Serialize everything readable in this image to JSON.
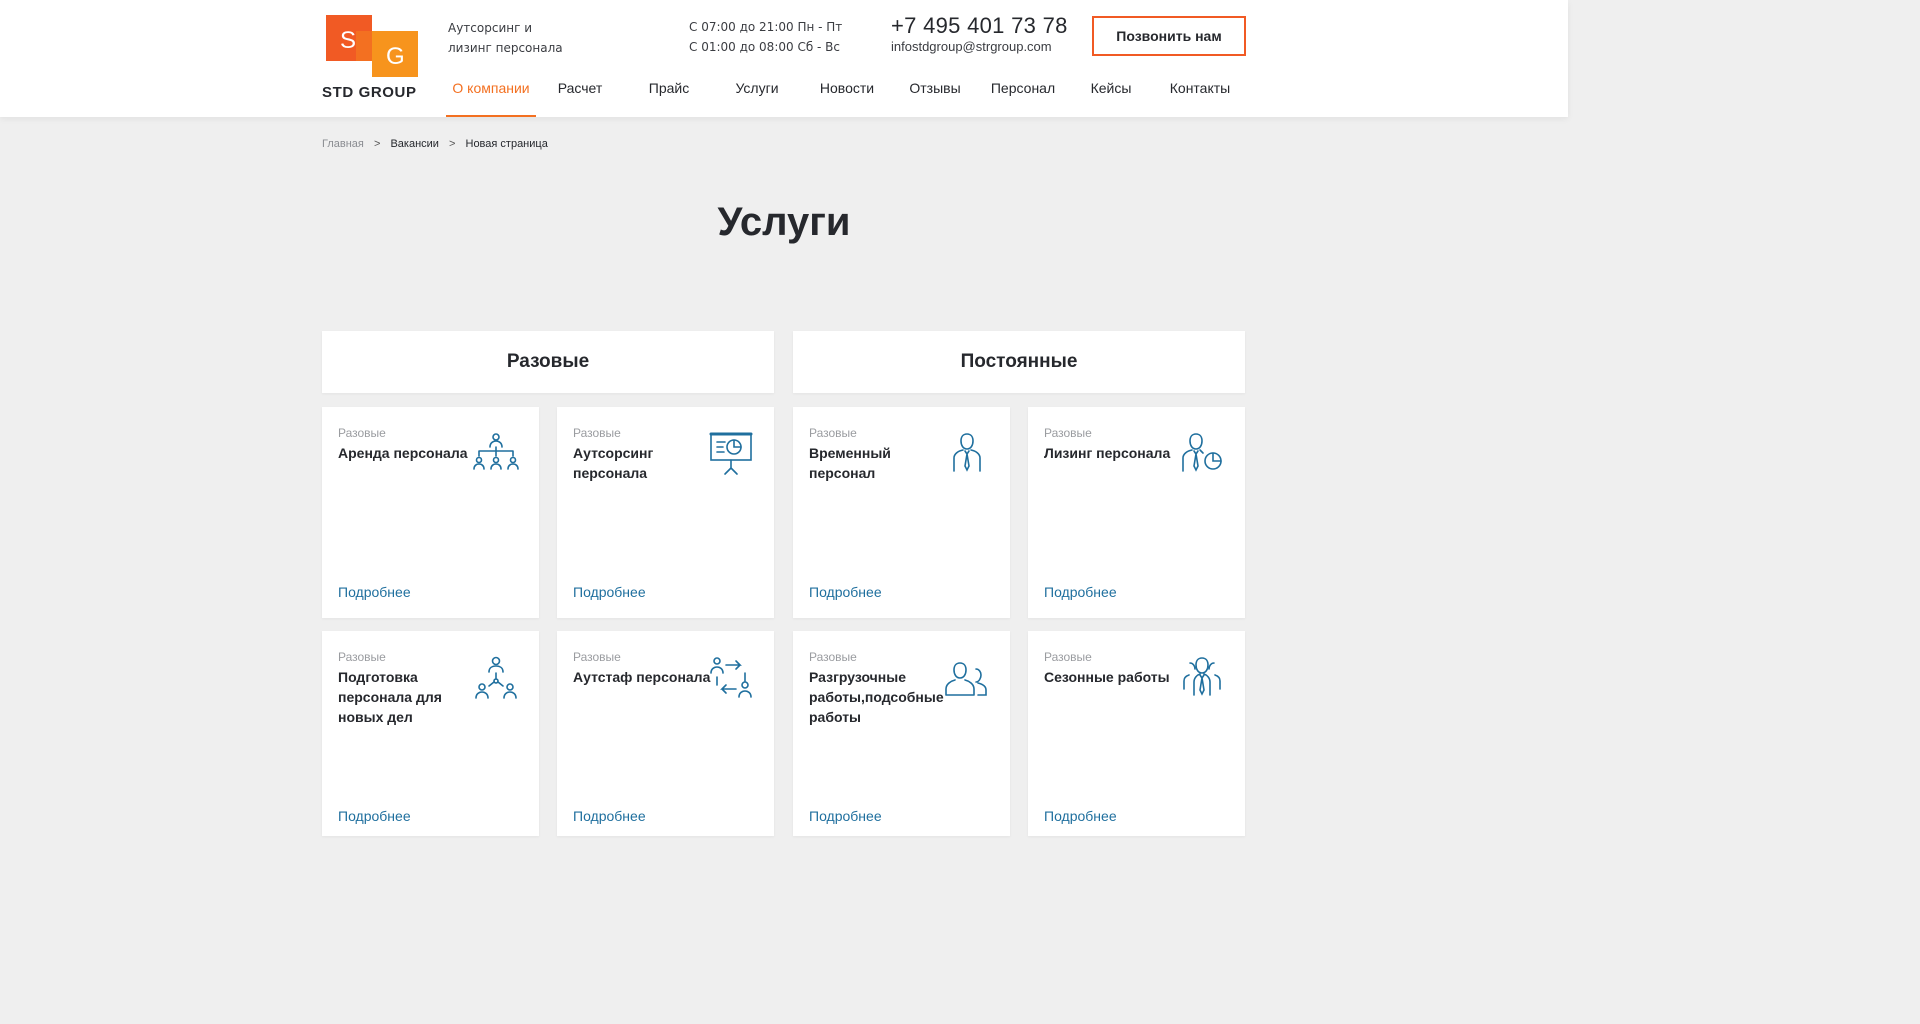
{
  "header": {
    "logo_letters": [
      "S",
      "G"
    ],
    "logo_text": "STD GROUP",
    "tagline": [
      "Аутсорсинг и",
      "лизинг персонала"
    ],
    "hours": [
      "С 07:00 до 21:00 Пн - Пт",
      "С 01:00 до 08:00 Сб - Вс"
    ],
    "phone": "+7 495 401 73 78",
    "email": "infostdgroup@strgroup.com",
    "call_button": "Позвонить нам"
  },
  "nav": {
    "items": [
      "О компании",
      "Расчет",
      "Прайс",
      "Услуги",
      "Новости",
      "Отзывы",
      "Персонал",
      "Кейсы",
      "Контакты"
    ],
    "active": "О компании"
  },
  "breadcrumb": [
    "Главная",
    "Вакансии",
    "Новая страница"
  ],
  "breadcrumb_sep": ">",
  "page_title": "Услуги",
  "categories": [
    "Разовые",
    "Постоянные"
  ],
  "cards": [
    {
      "category": "Разовые",
      "title": "Аренда персонала",
      "icon": "org-chart-icon",
      "link": "Подробнее"
    },
    {
      "category": "Разовые",
      "title": "Аутсорсинг персонала",
      "icon": "presentation-chart-icon",
      "link": "Подробнее"
    },
    {
      "category": "Разовые",
      "title": "Временный персонал",
      "icon": "person-tie-icon",
      "link": "Подробнее"
    },
    {
      "category": "Разовые",
      "title": "Лизинг персонала",
      "icon": "person-pie-chart-icon",
      "link": "Подробнее"
    },
    {
      "category": "Разовые",
      "title": "Подготовка персонала для новых дел",
      "icon": "team-network-icon",
      "link": "Подробнее"
    },
    {
      "category": "Разовые",
      "title": "Аутстаф персонала",
      "icon": "people-exchange-icon",
      "link": "Подробнее"
    },
    {
      "category": "Разовые",
      "title": "Разгрузочные работы,подсобные работы",
      "icon": "two-people-icon",
      "link": "Подробнее"
    },
    {
      "category": "Разовые",
      "title": "Сезонные работы",
      "icon": "three-people-icon",
      "link": "Подробнее"
    }
  ],
  "colors": {
    "accent": "#f37021",
    "logo_orange": "#f15a24",
    "link": "#1f6f9e",
    "icon": "#1f6f9e"
  }
}
